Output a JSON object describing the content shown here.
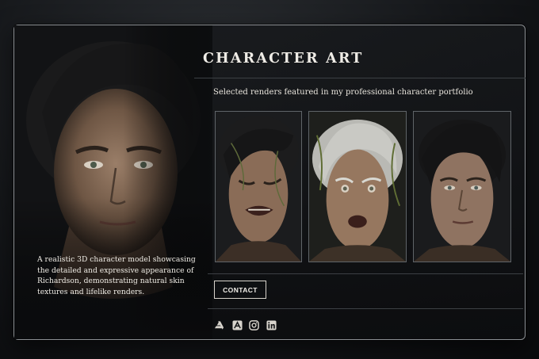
{
  "header": {
    "title": "CHARACTER ART",
    "subtitle": "Selected renders featured in my professional character portfolio"
  },
  "hero": {
    "caption": "A realistic 3D character model showcasing the detailed and expressive appearance of Richardson, demonstrating natural skin textures and lifelike renders."
  },
  "gallery": {
    "items": [
      {
        "expression": "grimacing"
      },
      {
        "expression": "surprised-aged"
      },
      {
        "expression": "neutral"
      }
    ]
  },
  "actions": {
    "contact_label": "CONTACT"
  },
  "social": {
    "icons": [
      "artstation-icon",
      "artstation-alt-icon",
      "instagram-icon",
      "linkedin-icon"
    ]
  },
  "colors": {
    "accent": "#d7d3cb",
    "border": "#8c9094",
    "background": "#0d0f12"
  }
}
